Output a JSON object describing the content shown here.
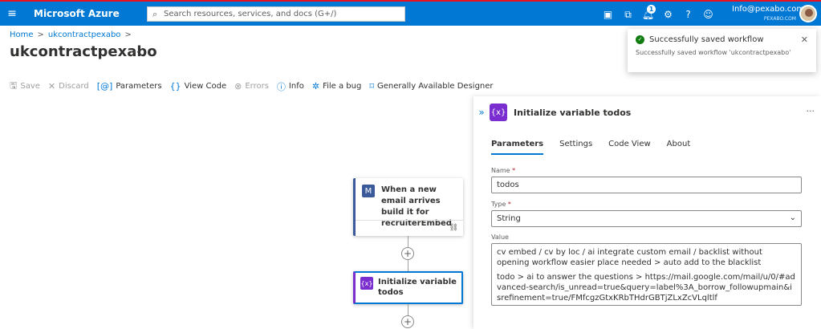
{
  "topbar": {
    "brand": "Microsoft Azure",
    "search_placeholder": "Search resources, services, and docs (G+/)",
    "notification_count": "1",
    "account_email": "Info@pexabo.com",
    "account_tenant": "PEXABO.COM"
  },
  "breadcrumb": {
    "home": "Home",
    "resource": "ukcontractpexabo",
    "sep": ">"
  },
  "page": {
    "title": "ukcontractpexabo",
    "more": "···"
  },
  "toolbar": {
    "save": "Save",
    "discard": "Discard",
    "parameters": "Parameters",
    "view_code": "View Code",
    "errors": "Errors",
    "info": "Info",
    "file_bug": "File a bug",
    "designer": "Generally Available Designer"
  },
  "canvas": {
    "trigger_label": "When a new email arrives build it for recruiterEmbed",
    "action_label": "Initialize variable todos"
  },
  "panel": {
    "title": "Initialize variable todos",
    "more": "···",
    "tabs": [
      "Parameters",
      "Settings",
      "Code View",
      "About"
    ],
    "name_label": "Name",
    "name_value": "todos",
    "type_label": "Type",
    "type_value": "String",
    "value_label": "Value",
    "value_line1": "cv  embed / cv by loc / ai integrate custom email / backlist without opening workflow easier place needed > auto add to the blacklist",
    "value_line2": "todo > ai to answer the questions > https://mail.google.com/mail/u/0/#advanced-search/is_unread=true&query=label%3A_borrow_followupmain&isrefinement=true/FMfcgzGtxKRbTHdrGBTjZLxZcVLqltlf"
  },
  "toast": {
    "title": "Successfully saved workflow",
    "message": "Successfully saved workflow 'ukcontractpexabo'"
  },
  "colors": {
    "accent": "#0078d4",
    "variable": "#7a2ecf",
    "success": "#107c10"
  }
}
